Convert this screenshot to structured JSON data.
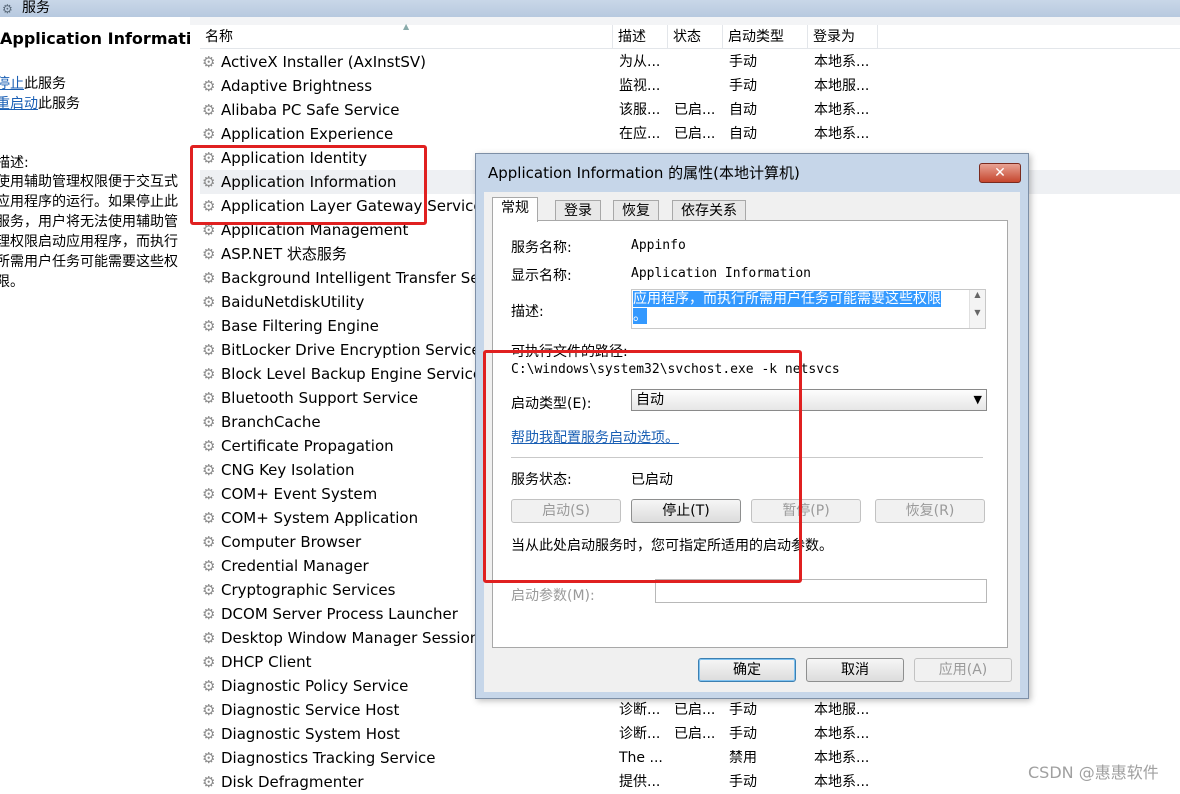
{
  "window": {
    "title": "服务"
  },
  "left_panel": {
    "title": "Application Information",
    "actions": [
      {
        "link": "停止",
        "suffix": "此服务"
      },
      {
        "link": "重启动",
        "suffix": "此服务"
      }
    ],
    "desc_label": "描述:",
    "desc_lines": [
      "使用辅助管理权限便于交互式",
      "应用程序的运行。如果停止此",
      "服务，用户将无法使用辅助管",
      "理权限启动应用程序，而执行",
      "所需用户任务可能需要这些权",
      "限。"
    ]
  },
  "list": {
    "columns": [
      "名称",
      "描述",
      "状态",
      "启动类型",
      "登录为"
    ],
    "rows": [
      {
        "name": "ActiveX Installer (AxInstSV)",
        "desc": "为从...",
        "status": "",
        "startup": "手动",
        "logon": "本地系..."
      },
      {
        "name": "Adaptive Brightness",
        "desc": "监视...",
        "status": "",
        "startup": "手动",
        "logon": "本地服..."
      },
      {
        "name": "Alibaba PC Safe Service",
        "desc": "该服...",
        "status": "已启...",
        "startup": "自动",
        "logon": "本地系..."
      },
      {
        "name": "Application Experience",
        "desc": "在应...",
        "status": "已启...",
        "startup": "自动",
        "logon": "本地系..."
      },
      {
        "name": "Application Identity",
        "desc": "",
        "status": "",
        "startup": "",
        "logon": ""
      },
      {
        "name": "Application Information",
        "desc": "",
        "status": "",
        "startup": "",
        "logon": ""
      },
      {
        "name": "Application Layer Gateway Service",
        "desc": "",
        "status": "",
        "startup": "",
        "logon": ""
      },
      {
        "name": "Application Management",
        "desc": "",
        "status": "",
        "startup": "",
        "logon": ""
      },
      {
        "name": "ASP.NET 状态服务",
        "desc": "",
        "status": "",
        "startup": "",
        "logon": ""
      },
      {
        "name": "Background Intelligent Transfer Ser",
        "desc": "",
        "status": "",
        "startup": "",
        "logon": ""
      },
      {
        "name": "BaiduNetdiskUtility",
        "desc": "",
        "status": "",
        "startup": "",
        "logon": ""
      },
      {
        "name": "Base Filtering Engine",
        "desc": "",
        "status": "",
        "startup": "",
        "logon": ""
      },
      {
        "name": "BitLocker Drive Encryption Service",
        "desc": "",
        "status": "",
        "startup": "",
        "logon": ""
      },
      {
        "name": "Block Level Backup Engine Service",
        "desc": "",
        "status": "",
        "startup": "",
        "logon": ""
      },
      {
        "name": "Bluetooth Support Service",
        "desc": "",
        "status": "",
        "startup": "",
        "logon": ""
      },
      {
        "name": "BranchCache",
        "desc": "",
        "status": "",
        "startup": "",
        "logon": ""
      },
      {
        "name": "Certificate Propagation",
        "desc": "",
        "status": "",
        "startup": "",
        "logon": ""
      },
      {
        "name": "CNG Key Isolation",
        "desc": "",
        "status": "",
        "startup": "",
        "logon": ""
      },
      {
        "name": "COM+ Event System",
        "desc": "",
        "status": "",
        "startup": "",
        "logon": ""
      },
      {
        "name": "COM+ System Application",
        "desc": "",
        "status": "",
        "startup": "",
        "logon": ""
      },
      {
        "name": "Computer Browser",
        "desc": "",
        "status": "",
        "startup": "",
        "logon": ""
      },
      {
        "name": "Credential Manager",
        "desc": "",
        "status": "",
        "startup": "",
        "logon": ""
      },
      {
        "name": "Cryptographic Services",
        "desc": "",
        "status": "",
        "startup": "",
        "logon": ""
      },
      {
        "name": "DCOM Server Process Launcher",
        "desc": "",
        "status": "",
        "startup": "",
        "logon": ""
      },
      {
        "name": "Desktop Window Manager Session",
        "desc": "",
        "status": "",
        "startup": "",
        "logon": ""
      },
      {
        "name": "DHCP Client",
        "desc": "",
        "status": "",
        "startup": "",
        "logon": ""
      },
      {
        "name": "Diagnostic Policy Service",
        "desc": "",
        "status": "",
        "startup": "",
        "logon": ""
      },
      {
        "name": "Diagnostic Service Host",
        "desc": "诊断...",
        "status": "已启...",
        "startup": "手动",
        "logon": "本地服..."
      },
      {
        "name": "Diagnostic System Host",
        "desc": "诊断...",
        "status": "已启...",
        "startup": "手动",
        "logon": "本地系..."
      },
      {
        "name": "Diagnostics Tracking Service",
        "desc": "The ...",
        "status": "",
        "startup": "禁用",
        "logon": "本地系..."
      },
      {
        "name": "Disk Defragmenter",
        "desc": "提供...",
        "status": "",
        "startup": "手动",
        "logon": "本地系..."
      }
    ]
  },
  "dialog": {
    "title": "Application Information 的属性(本地计算机)",
    "tabs": [
      "常规",
      "登录",
      "恢复",
      "依存关系"
    ],
    "service_name_label": "服务名称:",
    "service_name": "Appinfo",
    "display_name_label": "显示名称:",
    "display_name": "Application Information",
    "description_label": "描述:",
    "description_lines": [
      "应用程序，而执行所需用户任务可能需要这些权限",
      "。"
    ],
    "path_label": "可执行文件的路径:",
    "path": "C:\\windows\\system32\\svchost.exe -k netsvcs",
    "startup_type_label": "启动类型(E):",
    "startup_type": "自动",
    "help_link": "帮助我配置服务启动选项。",
    "status_label": "服务状态:",
    "status": "已启动",
    "buttons": {
      "start": "启动(S)",
      "stop": "停止(T)",
      "pause": "暂停(P)",
      "resume": "恢复(R)"
    },
    "hint": "当从此处启动服务时，您可指定所适用的启动参数。",
    "params_label": "启动参数(M):",
    "params_value": "",
    "ok": "确定",
    "cancel": "取消",
    "apply": "应用(A)"
  },
  "watermark": "CSDN @惠惠软件"
}
